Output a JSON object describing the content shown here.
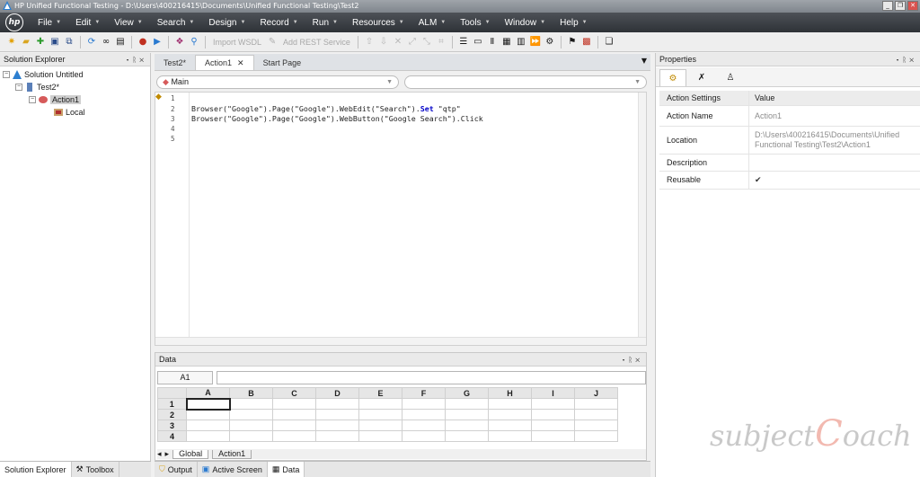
{
  "window": {
    "title": "HP Unified Functional Testing - D:\\Users\\400216415\\Documents\\Unified Functional Testing\\Test2",
    "controls": [
      "_",
      "❐",
      "✕"
    ]
  },
  "menubar": {
    "logo": "hp",
    "items": [
      "File",
      "Edit",
      "View",
      "Search",
      "Design",
      "Record",
      "Run",
      "Resources",
      "ALM",
      "Tools",
      "Window",
      "Help"
    ]
  },
  "toolbar": {
    "import_wsdl": "Import WSDL",
    "add_rest_service": "Add REST Service"
  },
  "solution_explorer": {
    "title": "Solution Explorer",
    "nodes": {
      "solution": "Solution Untitled",
      "test": "Test2*",
      "action": "Action1",
      "local": "Local"
    }
  },
  "left_bottom_tabs": [
    "Solution Explorer",
    "Toolbox"
  ],
  "doc_tabs": [
    "Test2*",
    "Action1",
    "Start Page"
  ],
  "editor": {
    "scope_combo": "Main",
    "line_numbers": [
      "1",
      "2",
      "3",
      "4",
      "5"
    ],
    "lines": {
      "l2_prefix": "Browser(\"Google\").Page(\"Google\").WebEdit(\"Search\").",
      "l2_keyword": "Set",
      "l2_suffix": " \"qtp\"",
      "l3": "Browser(\"Google\").Page(\"Google\").WebButton(\"Google Search\").Click"
    }
  },
  "data_pane": {
    "title": "Data",
    "cell_ref": "A1",
    "columns": [
      "A",
      "B",
      "C",
      "D",
      "E",
      "F",
      "G",
      "H",
      "I",
      "J"
    ],
    "rows": [
      "1",
      "2",
      "3",
      "4"
    ],
    "sheets": [
      "Global",
      "Action1"
    ]
  },
  "mid_bottom_tabs": [
    "Output",
    "Active Screen",
    "Data"
  ],
  "properties": {
    "title": "Properties",
    "header": {
      "name": "Action Settings",
      "value": "Value"
    },
    "rows": [
      {
        "name": "Action Name",
        "value": "Action1"
      },
      {
        "name": "Location",
        "value": "D:\\Users\\400216415\\Documents\\Unified Functional Testing\\Test2\\Action1"
      },
      {
        "name": "Description",
        "value": ""
      },
      {
        "name": "Reusable",
        "value": "✔"
      }
    ]
  },
  "watermark": {
    "a": "subject",
    "b": "C",
    "c": "oach"
  },
  "colors": {
    "menubar": "#3a3e44",
    "selection": "#cfcfcf",
    "keyword": "#0000c8"
  }
}
